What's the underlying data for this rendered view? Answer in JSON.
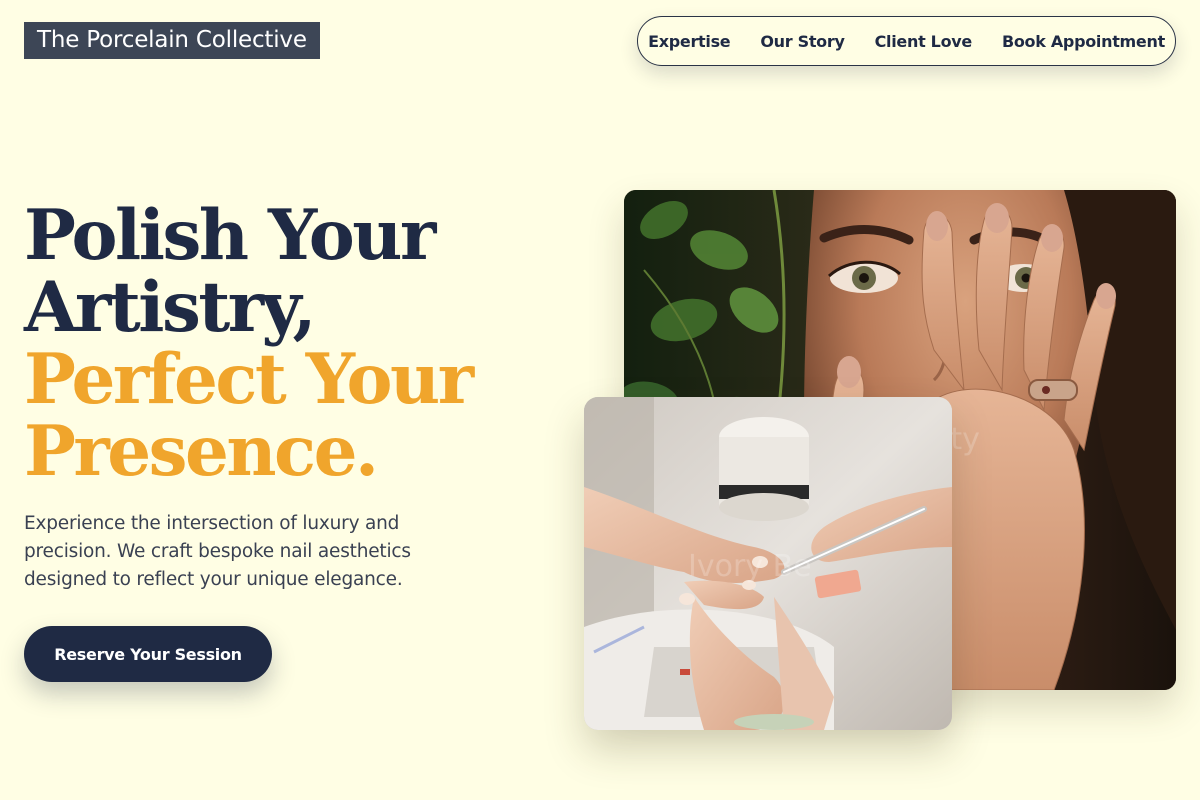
{
  "brand": {
    "name": "The Porcelain Collective"
  },
  "nav": {
    "items": [
      {
        "label": "Expertise"
      },
      {
        "label": "Our Story"
      },
      {
        "label": "Client Love"
      },
      {
        "label": "Book Appointment"
      }
    ]
  },
  "hero": {
    "title_line1": "Polish Your",
    "title_line2": "Artistry,",
    "title_line3": "Perfect Your",
    "title_line4": "Presence.",
    "description": "Experience the intersection of luxury and precision. We craft bespoke nail aesthetics designed to reflect your unique elegance.",
    "cta_label": "Reserve Your Session"
  },
  "images": {
    "large_alt": "Woman with nude manicure covering part of her face beside green leaves",
    "small_alt": "Nail technician filing a client's nails at a manicure table",
    "large_overlay": "ity",
    "small_overlay": "Ivory Be"
  },
  "colors": {
    "background": "#fffee4",
    "navy": "#1f2a44",
    "accent": "#f0a52c",
    "logo_bg": "#3d4656"
  }
}
